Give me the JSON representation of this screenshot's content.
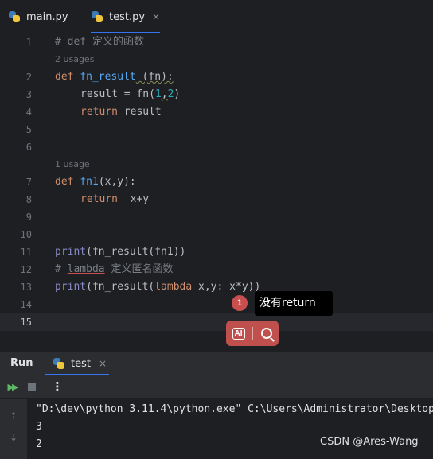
{
  "tabs": [
    {
      "label": "main.py",
      "icon": "python-file-icon",
      "active": false
    },
    {
      "label": "test.py",
      "icon": "python-file-icon",
      "active": true,
      "close": "×"
    }
  ],
  "editor": {
    "lines": [
      {
        "n": "1"
      },
      {
        "n": "2"
      },
      {
        "n": "3"
      },
      {
        "n": "4"
      },
      {
        "n": "5"
      },
      {
        "n": "6"
      },
      {
        "n": "7"
      },
      {
        "n": "8"
      },
      {
        "n": "9"
      },
      {
        "n": "10"
      },
      {
        "n": "11"
      },
      {
        "n": "12"
      },
      {
        "n": "13"
      },
      {
        "n": "14"
      },
      {
        "n": "15"
      }
    ],
    "hints": {
      "fn_result_usages": "2 usages",
      "fn1_usages": "1 usage"
    },
    "code": {
      "l1": "# def 定义的函数",
      "l2_kw": "def",
      "l2_name": "fn_result",
      "l2_rest": " (fn):",
      "l3_a": "result = fn(",
      "l3_n1": "1",
      "l3_c": ",",
      "l3_n2": "2",
      "l3_b": ")",
      "l4_kw": "return",
      "l4_rest": " result",
      "l7_kw": "def",
      "l7_name": "fn1",
      "l7_rest": "(x,y):",
      "l8_kw": "return",
      "l8_rest": "  x+y",
      "l11_builtin": "print",
      "l11_rest": "(fn_result(fn1))",
      "l12_a": "# ",
      "l12_b": "lambda",
      "l12_c": " 定义匿名函数",
      "l13_builtin": "print",
      "l13_a": "(fn_result(",
      "l13_kw": "lambda",
      "l13_b": " x,y: x*y))"
    }
  },
  "annotation": {
    "badge": "1",
    "text": "没有return"
  },
  "ai_toolbar": {
    "ai_icon_text": "AI",
    "search_icon": "search-icon"
  },
  "run_panel": {
    "title": "Run",
    "tab": "test",
    "tab_close": "×",
    "output": [
      "\"D:\\dev\\python 3.11.4\\python.exe\" C:\\Users\\Administrator\\Desktop",
      "3",
      "2"
    ]
  },
  "watermark": "CSDN @Ares-Wang",
  "colors": {
    "accent": "#3574f0",
    "keyword": "#cf8e6d",
    "function": "#56a8f5",
    "number": "#2aacb8",
    "badge": "#c94f4f"
  }
}
